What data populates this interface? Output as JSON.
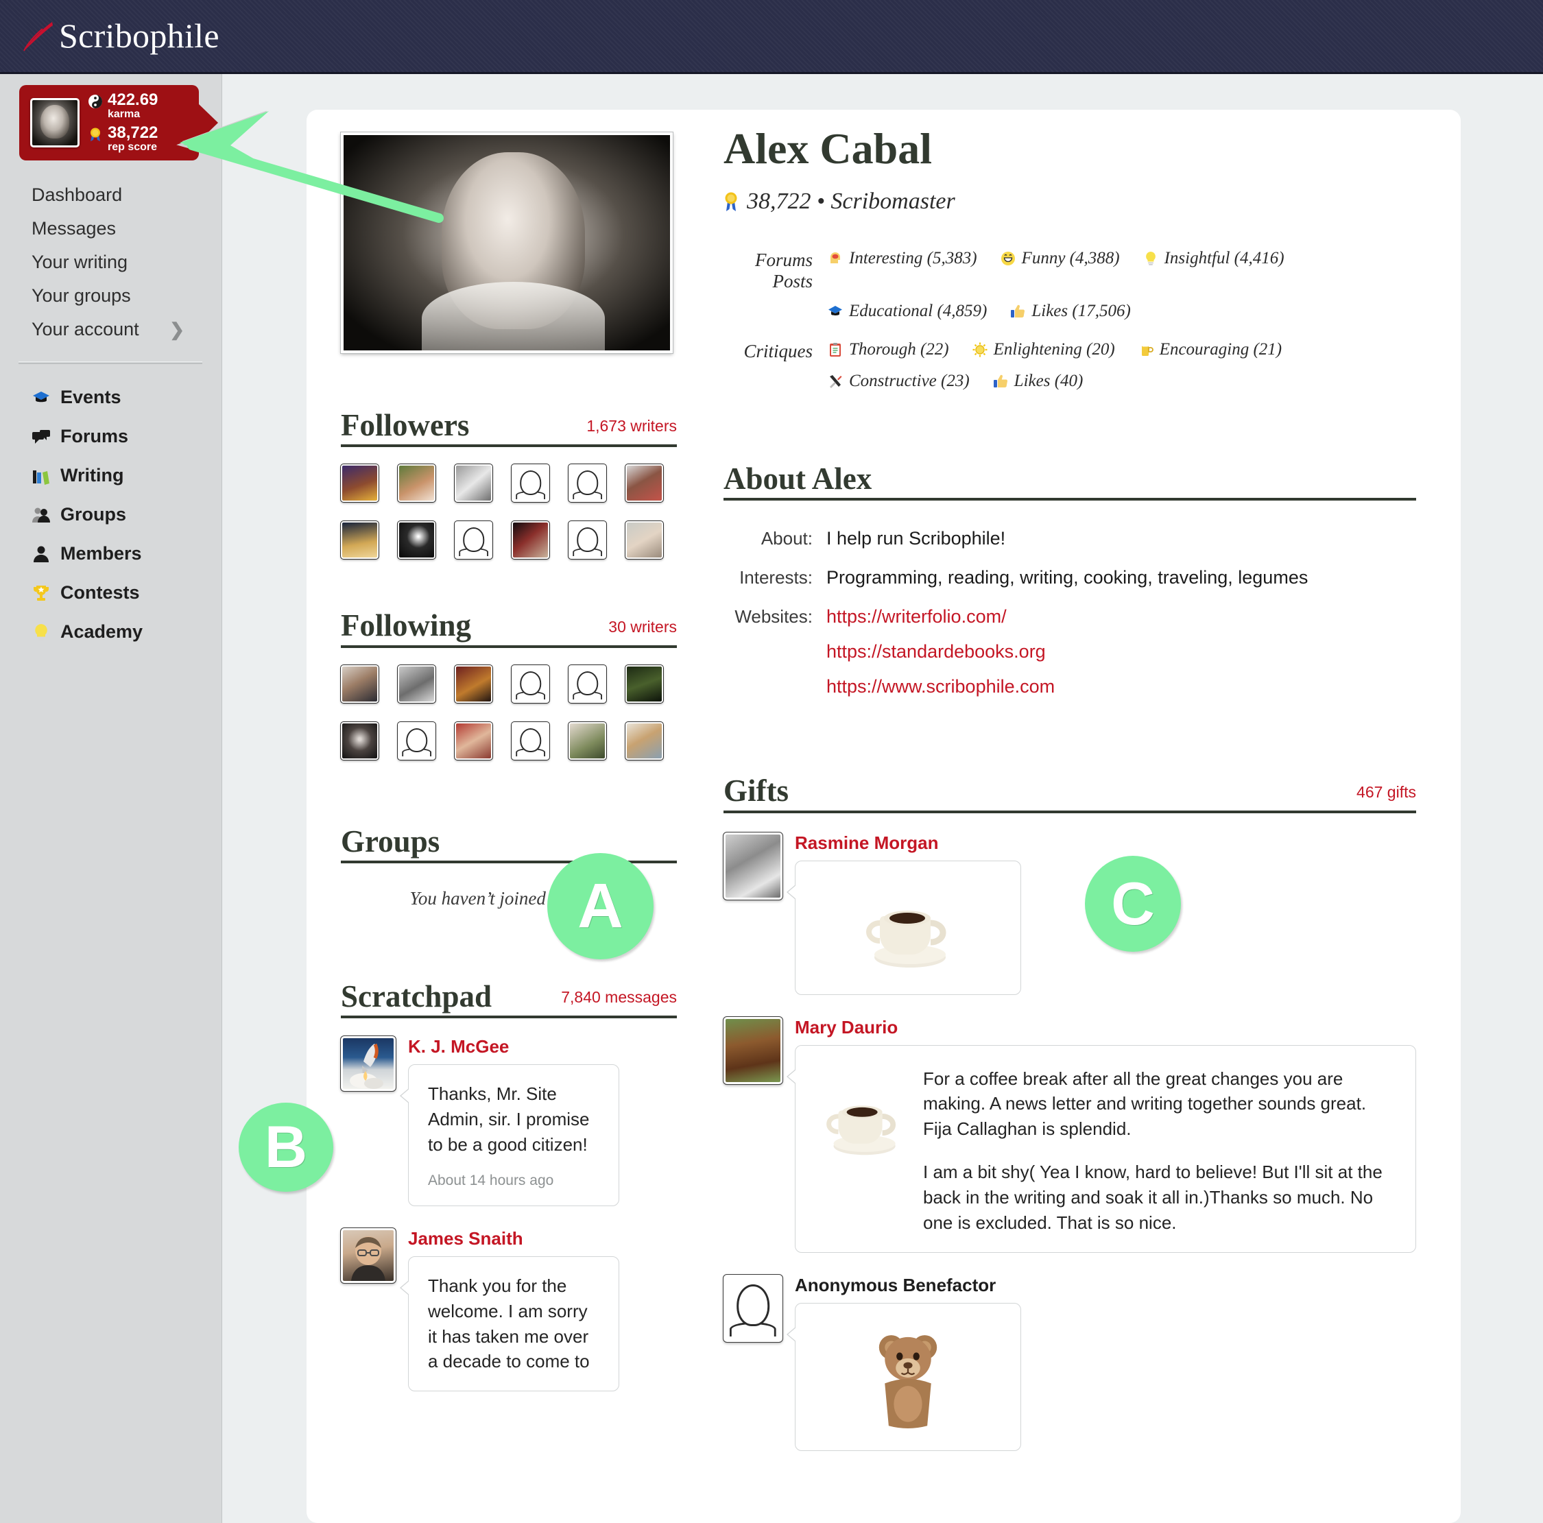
{
  "site": {
    "name": "Scribophile",
    "logo_icon": "slash-quill-icon"
  },
  "user_badge": {
    "karma_value": "422.69",
    "karma_label": "karma",
    "karma_icon": "yin-yang-icon",
    "rep_value": "38,722",
    "rep_label": "rep score",
    "rep_icon": "award-ribbon-icon",
    "avatar_icon": "user-avatar-photo"
  },
  "sidebar": {
    "plain_items": [
      {
        "label": "Dashboard",
        "icon": null
      },
      {
        "label": "Messages",
        "icon": null
      },
      {
        "label": "Your writing",
        "icon": null
      },
      {
        "label": "Your groups",
        "icon": null
      },
      {
        "label": "Your account",
        "icon": "chevron-right-icon"
      }
    ],
    "icon_items": [
      {
        "label": "Events",
        "icon": "graduation-cap-icon"
      },
      {
        "label": "Forums",
        "icon": "speech-bubbles-icon"
      },
      {
        "label": "Writing",
        "icon": "books-icon"
      },
      {
        "label": "Groups",
        "icon": "two-people-icon"
      },
      {
        "label": "Members",
        "icon": "person-icon"
      },
      {
        "label": "Contests",
        "icon": "trophy-icon"
      },
      {
        "label": "Academy",
        "icon": "lightbulb-icon"
      }
    ]
  },
  "profile": {
    "photo_icon": "profile-photo",
    "name": "Alex Cabal",
    "rep_icon": "award-ribbon-icon",
    "rep_line": "38,722 • Scribomaster",
    "stats": [
      {
        "label": "Forums Posts",
        "items": [
          {
            "icon": "head-brain-icon",
            "text": "Interesting (5,383)"
          },
          {
            "icon": "grinning-face-icon",
            "text": "Funny (4,388)"
          },
          {
            "icon": "lightbulb-icon",
            "text": "Insightful (4,416)"
          },
          {
            "icon": "graduation-cap-icon",
            "text": "Educational (4,859)"
          },
          {
            "icon": "thumbs-up-icon",
            "text": "Likes (17,506)"
          }
        ]
      },
      {
        "label": "Critiques",
        "items": [
          {
            "icon": "clipboard-icon",
            "text": "Thorough (22)"
          },
          {
            "icon": "sun-icon",
            "text": "Enlightening (20)"
          },
          {
            "icon": "beer-mug-icon",
            "text": "Encouraging (21)"
          },
          {
            "icon": "hammer-wrench-icon",
            "text": "Constructive (23)"
          },
          {
            "icon": "thumbs-up-icon",
            "text": "Likes (40)"
          }
        ]
      }
    ]
  },
  "followers": {
    "title": "Followers",
    "count": "1,673 writers",
    "avatars": [
      {
        "icon": "avatar-photo",
        "blank": false,
        "style": "art-purple"
      },
      {
        "icon": "avatar-photo",
        "blank": false,
        "style": "woman-green"
      },
      {
        "icon": "avatar-photo",
        "blank": false,
        "style": "unicorn-bw"
      },
      {
        "icon": "avatar-placeholder",
        "blank": true,
        "style": ""
      },
      {
        "icon": "avatar-placeholder",
        "blank": true,
        "style": ""
      },
      {
        "icon": "avatar-photo",
        "blank": false,
        "style": "woman-coral"
      },
      {
        "icon": "avatar-photo",
        "blank": false,
        "style": "beach-gold"
      },
      {
        "icon": "avatar-photo",
        "blank": false,
        "style": "dark-comet"
      },
      {
        "icon": "avatar-placeholder",
        "blank": true,
        "style": ""
      },
      {
        "icon": "avatar-photo",
        "blank": false,
        "style": "night-red"
      },
      {
        "icon": "avatar-placeholder",
        "blank": true,
        "style": ""
      },
      {
        "icon": "avatar-photo",
        "blank": false,
        "style": "woman-grey"
      }
    ]
  },
  "following": {
    "title": "Following",
    "count": "30 writers",
    "avatars": [
      {
        "icon": "avatar-photo",
        "blank": false,
        "style": "bald-man"
      },
      {
        "icon": "avatar-photo",
        "blank": false,
        "style": "child-bw"
      },
      {
        "icon": "avatar-photo",
        "blank": false,
        "style": "podium-man"
      },
      {
        "icon": "avatar-placeholder",
        "blank": true,
        "style": ""
      },
      {
        "icon": "avatar-placeholder",
        "blank": true,
        "style": ""
      },
      {
        "icon": "avatar-photo",
        "blank": false,
        "style": "forest-dark"
      },
      {
        "icon": "avatar-photo",
        "blank": false,
        "style": "dark-woman"
      },
      {
        "icon": "avatar-placeholder",
        "blank": true,
        "style": ""
      },
      {
        "icon": "avatar-photo",
        "blank": false,
        "style": "group-red"
      },
      {
        "icon": "avatar-placeholder",
        "blank": true,
        "style": ""
      },
      {
        "icon": "avatar-photo",
        "blank": false,
        "style": "hug-green"
      },
      {
        "icon": "avatar-photo",
        "blank": false,
        "style": "blonde-woman"
      }
    ]
  },
  "groups": {
    "title": "Groups",
    "empty_text": "You haven’t joined any yet."
  },
  "scratchpad": {
    "title": "Scratchpad",
    "count": "7,840 messages",
    "messages": [
      {
        "author": "K. J. McGee",
        "avatar_icon": "rocket-launch-avatar",
        "text": "Thanks, Mr. Site Admin, sir. I promise to be a good citizen!",
        "stamp": "About 14 hours ago"
      },
      {
        "author": "James Snaith",
        "avatar_icon": "man-glasses-avatar",
        "text": "Thank you for the welcome. I am sorry it has taken me over a decade to come to"
      }
    ]
  },
  "about": {
    "title": "About Alex",
    "rows": [
      {
        "key": "About:",
        "value": "I help run Scribophile!",
        "links": []
      },
      {
        "key": "Interests:",
        "value": "Programming, reading, writing, cooking, traveling, legumes",
        "links": []
      },
      {
        "key": "Websites:",
        "value": "",
        "links": [
          "https://writerfolio.com/",
          "https://standardebooks.org",
          "https://www.scribophile.com"
        ]
      }
    ]
  },
  "gifts": {
    "title": "Gifts",
    "count": "467 gifts",
    "items": [
      {
        "sender": "Rasmine Morgan",
        "sender_anonymous": false,
        "avatar_icon": "grey-photo-avatar",
        "gift_icon": "coffee-cup-icon",
        "paragraphs": []
      },
      {
        "sender": "Mary Daurio",
        "sender_anonymous": false,
        "avatar_icon": "horse-rider-avatar",
        "gift_icon": "coffee-cup-icon",
        "paragraphs": [
          "For a coffee break after all the great changes you are making. A news letter and writing together sounds great. Fija Callaghan is splendid.",
          "I am a bit shy( Yea I know, hard to believe! But I'll sit at the back in the writing and soak it all in.)Thanks so much. No one is excluded. That is so nice."
        ]
      },
      {
        "sender": "Anonymous Benefactor",
        "sender_anonymous": true,
        "avatar_icon": "avatar-placeholder",
        "gift_icon": "teddy-bear-icon",
        "paragraphs": []
      }
    ]
  },
  "annotations": {
    "markers": [
      {
        "letter": "A",
        "id": "mk-a"
      },
      {
        "letter": "B",
        "id": "mk-b"
      },
      {
        "letter": "C",
        "id": "mk-c"
      }
    ],
    "arrow_icon": "green-arrow-pointing-to-rep-score",
    "color": "#7cefa0"
  }
}
